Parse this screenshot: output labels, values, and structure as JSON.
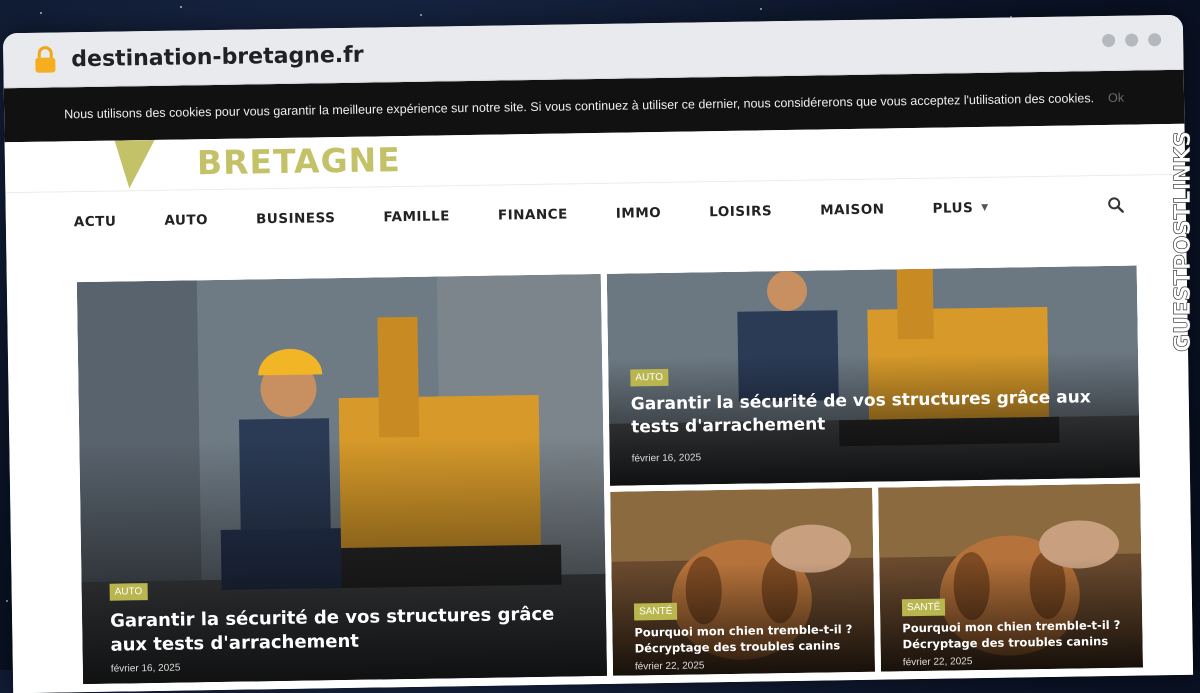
{
  "browser": {
    "url": "destination-bretagne.fr"
  },
  "cookie_bar": {
    "message": "Nous utilisons des cookies pour vous garantir la meilleure expérience sur notre site. Si vous continuez à utiliser ce dernier, nous considérerons que vous acceptez l'utilisation des cookies.",
    "ok_label": "Ok"
  },
  "site": {
    "logo_text": "BRETAGNE",
    "accent_color": "#c4c268"
  },
  "nav": {
    "items": [
      "ACTU",
      "AUTO",
      "BUSINESS",
      "FAMILLE",
      "FINANCE",
      "IMMO",
      "LOISIRS",
      "MAISON"
    ],
    "more_label": "PLUS",
    "search_icon": "search-icon"
  },
  "articles": [
    {
      "category": "AUTO",
      "title": "Garantir la sécurité de vos structures grâce aux tests d'arrachement",
      "date": "février 16, 2025"
    },
    {
      "category": "AUTO",
      "title": "Garantir la sécurité de vos structures grâce aux tests d'arrachement",
      "date": "février 16, 2025"
    },
    {
      "category": "SANTÉ",
      "title": "Pourquoi mon chien tremble-t-il ? Décryptage des troubles canins",
      "date": "février 22, 2025"
    },
    {
      "category": "SANTÉ",
      "title": "Pourquoi mon chien tremble-t-il ? Décryptage des troubles canins",
      "date": "février 22, 2025"
    }
  ],
  "side_banner": {
    "text": "GUESTPOSTLINKS"
  }
}
